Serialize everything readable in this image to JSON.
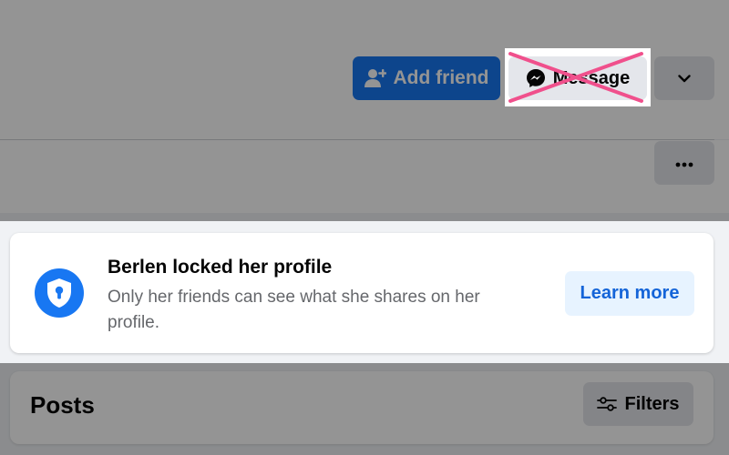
{
  "profile_actions": {
    "add_friend_label": "Add friend",
    "add_friend_icon": "person-add-icon",
    "message_label": "Message",
    "message_icon": "messenger-icon",
    "dropdown_icon": "chevron-down-icon"
  },
  "profile_tabs": {
    "more_icon": "ellipsis-icon"
  },
  "locked_notice": {
    "icon": "shield-lock-icon",
    "title": "Berlen locked her profile",
    "description": "Only her friends can see what she shares on her profile.",
    "learn_more_label": "Learn more"
  },
  "posts": {
    "title": "Posts",
    "filters_label": "Filters",
    "filters_icon": "sliders-icon"
  },
  "colors": {
    "brand_blue": "#1877f2",
    "secondary_button": "#e4e6eb",
    "learn_more_bg": "#e7f3ff",
    "cross_mark": "#f0508c"
  }
}
